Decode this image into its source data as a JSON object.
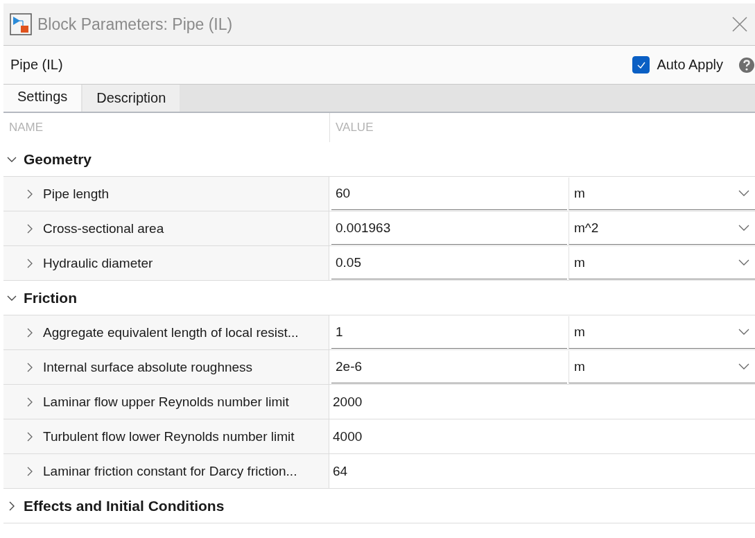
{
  "window": {
    "title": "Block Parameters: Pipe (IL)"
  },
  "block_name": "Pipe (IL)",
  "auto_apply": {
    "label": "Auto Apply",
    "checked": true
  },
  "tabs": [
    {
      "label": "Settings",
      "selected": true
    },
    {
      "label": "Description",
      "selected": false
    }
  ],
  "table": {
    "columns": [
      "NAME",
      "VALUE"
    ],
    "groups": [
      {
        "title": "Geometry",
        "expanded": true,
        "parameters": [
          {
            "kind": "unit",
            "name": "Pipe length",
            "value": "60",
            "unit": "m"
          },
          {
            "kind": "unit",
            "name": "Cross-sectional area",
            "value": "0.001963",
            "unit": "m^2"
          },
          {
            "kind": "unit",
            "name": "Hydraulic diameter",
            "value": "0.05",
            "unit": "m"
          }
        ]
      },
      {
        "title": "Friction",
        "expanded": true,
        "parameters": [
          {
            "kind": "unit",
            "name": "Aggregate equivalent length of local resist...",
            "value": "1",
            "unit": "m"
          },
          {
            "kind": "unit",
            "name": "Internal surface absolute roughness",
            "value": "2e-6",
            "unit": "m"
          },
          {
            "kind": "plain",
            "name": "Laminar flow upper Reynolds number limit",
            "value": "2000"
          },
          {
            "kind": "plain",
            "name": "Turbulent flow lower Reynolds number limit",
            "value": "4000"
          },
          {
            "kind": "plain",
            "name": "Laminar friction constant for Darcy friction...",
            "value": "64"
          }
        ]
      },
      {
        "title": "Effects and Initial Conditions",
        "expanded": false
      }
    ]
  }
}
